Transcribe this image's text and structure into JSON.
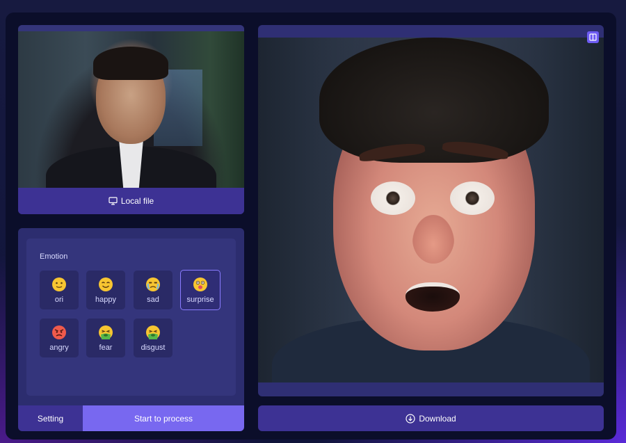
{
  "upload": {
    "local_file_label": "Local file"
  },
  "emotion": {
    "title": "Emotion",
    "options": [
      {
        "label": "ori",
        "icon": "slight-smile-face-icon"
      },
      {
        "label": "happy",
        "icon": "smiling-face-icon"
      },
      {
        "label": "sad",
        "icon": "crying-face-icon"
      },
      {
        "label": "surprise",
        "icon": "surprised-tongue-face-icon",
        "selected": true
      },
      {
        "label": "angry",
        "icon": "angry-face-icon"
      },
      {
        "label": "fear",
        "icon": "nauseated-face-icon"
      },
      {
        "label": "disgust",
        "icon": "vomiting-face-icon"
      }
    ]
  },
  "actions": {
    "setting_label": "Setting",
    "process_label": "Start to process",
    "download_label": "Download"
  },
  "colors": {
    "accent": "#7868f0",
    "button": "#3d3294",
    "panel": "#2c2d6f"
  }
}
